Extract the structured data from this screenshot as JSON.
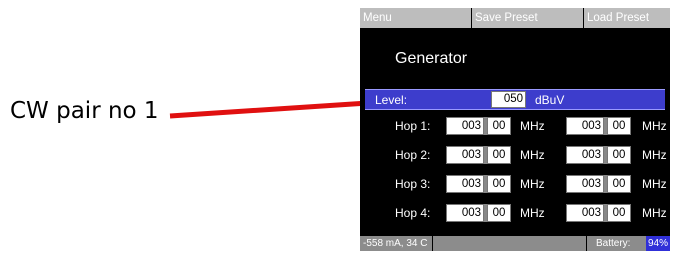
{
  "annotation": {
    "label": "CW pair no 1",
    "arrow_color": "#e01010"
  },
  "menu": {
    "menu": "Menu",
    "save_preset": "Save Preset",
    "load_preset": "Load Preset"
  },
  "screen": {
    "title": "Generator"
  },
  "level": {
    "label": "Level:",
    "value": "050",
    "unit": "dBuV"
  },
  "hops": [
    {
      "label": "Hop 1:",
      "f1_int": "003",
      "f1_dec": "00",
      "f2_int": "003",
      "f2_dec": "00",
      "unit": "MHz"
    },
    {
      "label": "Hop 2:",
      "f1_int": "003",
      "f1_dec": "00",
      "f2_int": "003",
      "f2_dec": "00",
      "unit": "MHz"
    },
    {
      "label": "Hop 3:",
      "f1_int": "003",
      "f1_dec": "00",
      "f2_int": "003",
      "f2_dec": "00",
      "unit": "MHz"
    },
    {
      "label": "Hop 4:",
      "f1_int": "003",
      "f1_dec": "00",
      "f2_int": "003",
      "f2_dec": "00",
      "unit": "MHz"
    }
  ],
  "status": {
    "current_temp": "-558 mA, 34 C",
    "battery_label": "Battery:",
    "battery_value": "94%"
  },
  "colors": {
    "selection": "#3d3dcc",
    "battery_badge": "#3030d8",
    "menubar": "#bdbdbd",
    "statusbar": "#8c8c8c"
  }
}
